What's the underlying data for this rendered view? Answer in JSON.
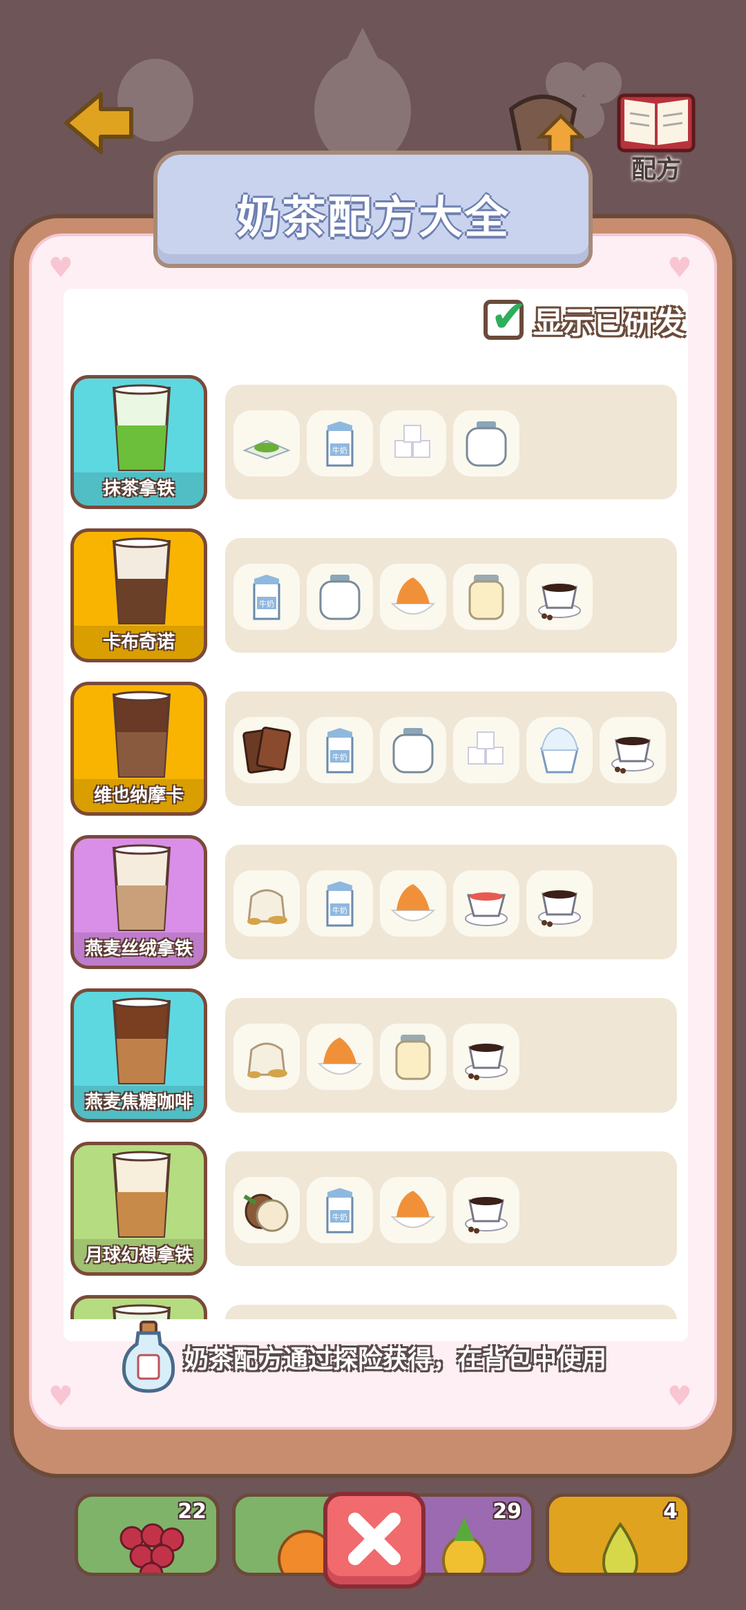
{
  "header": {
    "back_icon": "back-arrow-icon",
    "upgrade_label": "升级",
    "recipe_label": "配方"
  },
  "panel": {
    "title": "奶茶配方大全",
    "show_developed_label": "显示已研发",
    "show_developed_checked": true,
    "footer_note": "奶茶配方通过探险获得，在背包中使用"
  },
  "recipes": [
    {
      "name": "抹茶拿铁",
      "card_color": "#5dd8e0",
      "ingredients": [
        "matcha-powder-icon",
        "milk-carton-icon",
        "sugar-cubes-icon",
        "glass-jar-icon"
      ]
    },
    {
      "name": "卡布奇诺",
      "card_color": "#f8b400",
      "ingredients": [
        "milk-carton-icon",
        "glass-jar-icon",
        "cream-bowl-icon",
        "condensed-milk-jar-icon",
        "coffee-cup-icon"
      ]
    },
    {
      "name": "维也纳摩卡",
      "card_color": "#f8b400",
      "ingredients": [
        "chocolate-bar-icon",
        "milk-carton-icon",
        "glass-jar-icon",
        "sugar-cubes-icon",
        "ice-cream-cup-icon",
        "coffee-cup-icon"
      ]
    },
    {
      "name": "燕麦丝绒拿铁",
      "card_color": "#d98ee8",
      "ingredients": [
        "oat-sack-icon",
        "milk-carton-icon",
        "cream-bowl-icon",
        "black-tea-cup-icon",
        "coffee-cup-icon"
      ]
    },
    {
      "name": "燕麦焦糖咖啡",
      "card_color": "#5dd8e0",
      "ingredients": [
        "oat-sack-icon",
        "cream-bowl-icon",
        "condensed-milk-jar-icon",
        "coffee-cup-icon"
      ]
    },
    {
      "name": "月球幻想拿铁",
      "card_color": "#b5dc80",
      "ingredients": [
        "hazelnut-icon",
        "milk-carton-icon",
        "cream-bowl-icon",
        "coffee-cup-icon"
      ]
    },
    {
      "name": "",
      "card_color": "#b5dc80",
      "ingredients": []
    }
  ],
  "inventory": [
    {
      "item": "grapes-icon",
      "count": "22",
      "color": "#7fb36a"
    },
    {
      "item": "orange-icon",
      "count": "",
      "color": "#7fb36a"
    },
    {
      "item": "pineapple-icon",
      "count": "29",
      "color": "#9b6ab0"
    },
    {
      "item": "pear-icon",
      "count": "4",
      "color": "#e0a31f"
    }
  ],
  "close_icon": "close-x-icon"
}
